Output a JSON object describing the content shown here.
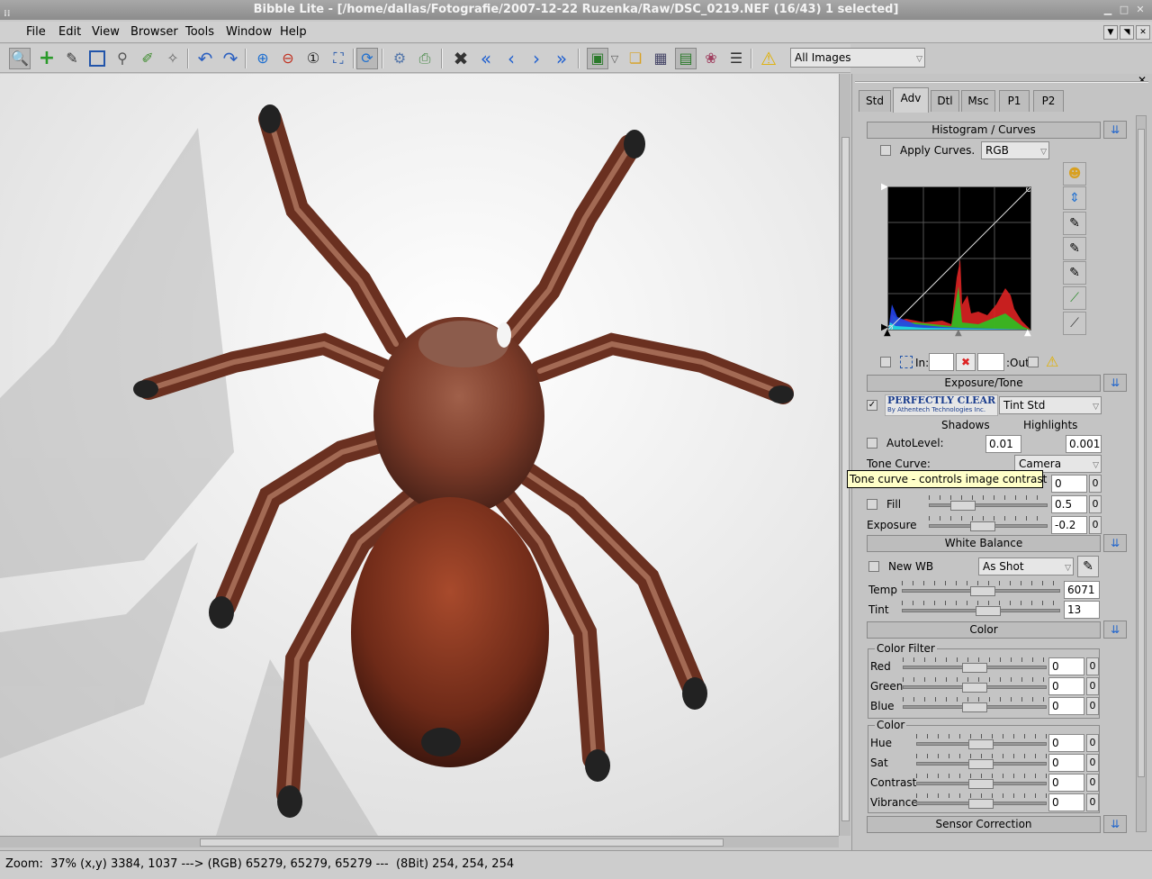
{
  "window": {
    "title": "Bibble Lite - [/home/dallas/Fotografie/2007-12-22 Ruzenka/Raw/DSC_0219.NEF (16/43) 1 selected]"
  },
  "menu": {
    "items": [
      "File",
      "Edit",
      "View",
      "Browser",
      "Tools",
      "Window",
      "Help"
    ]
  },
  "toolbar": {
    "filter_value": "All Images",
    "icons": [
      "magnifier-tool-icon",
      "add-icon",
      "eyedropper-icon",
      "crop-icon",
      "zoom-lens-icon",
      "brush-icon",
      "heal-icon",
      "undo-icon",
      "redo-icon",
      "zoom-in-icon",
      "zoom-out-icon",
      "zoom-100-icon",
      "zoom-fit-icon",
      "refresh-icon",
      "settings-icon",
      "print-icon",
      "delete-icon",
      "first-image-icon",
      "previous-image-icon",
      "next-image-icon",
      "last-image-icon",
      "image-view-icon",
      "thumbnails-icon",
      "batch-icon",
      "editor-icon",
      "color-icon",
      "info-icon",
      "warning-icon"
    ]
  },
  "panel": {
    "tabs": [
      "Std",
      "Adv",
      "Dtl",
      "Msc",
      "P1",
      "P2"
    ],
    "active_tab": "Adv",
    "histogram": {
      "section_title": "Histogram / Curves",
      "apply_curves_label": "Apply Curves.",
      "channel": "RGB",
      "in_label": "In:",
      "out_label": ":Out"
    },
    "exposure": {
      "section_title": "Exposure/Tone",
      "pc_logo_line1": "PERFECTLY CLEAR",
      "pc_logo_line2": "By Athentech Technologies Inc.",
      "pc_mode": "Tint Std",
      "pc_checked": true,
      "shadows_label": "Shadows",
      "highlights_label": "Highlights",
      "autolevel_label": "AutoLevel:",
      "shadows_value": "0.01",
      "highlights_value": "0.001",
      "tone_curve_label": "Tone Curve:",
      "tone_curve_value": "Camera",
      "contrast_value": "0",
      "contrast_reset": "0",
      "fill_label": "Fill",
      "fill_value": "0.5",
      "fill_reset": "0",
      "exposure_label": "Exposure",
      "exposure_value": "-0.2",
      "exposure_reset": "0",
      "tooltip": "Tone curve - controls image contrast"
    },
    "white_balance": {
      "section_title": "White Balance",
      "new_wb_label": "New WB",
      "mode": "As Shot",
      "temp_label": "Temp",
      "temp_value": "6071",
      "tint_label": "Tint",
      "tint_value": "13"
    },
    "color": {
      "section_title": "Color",
      "filter_group": "Color Filter",
      "red_label": "Red",
      "red_value": "0",
      "red_reset": "0",
      "green_label": "Green",
      "green_value": "0",
      "green_reset": "0",
      "blue_label": "Blue",
      "blue_value": "0",
      "blue_reset": "0",
      "color_group": "Color",
      "hue_label": "Hue",
      "hue_value": "0",
      "hue_reset": "0",
      "sat_label": "Sat",
      "sat_value": "0",
      "sat_reset": "0",
      "contrast_label": "Contrast",
      "contrast_value": "0",
      "contrast_reset": "0",
      "vibrance_label": "Vibrance",
      "vibrance_value": "0",
      "vibrance_reset": "0"
    },
    "sensor": {
      "section_title": "Sensor Correction"
    }
  },
  "status": {
    "text": "Zoom:  37% (x,y) 3384, 1037 ---> (RGB) 65279, 65279, 65279 ---  (8Bit) 254, 254, 254"
  }
}
